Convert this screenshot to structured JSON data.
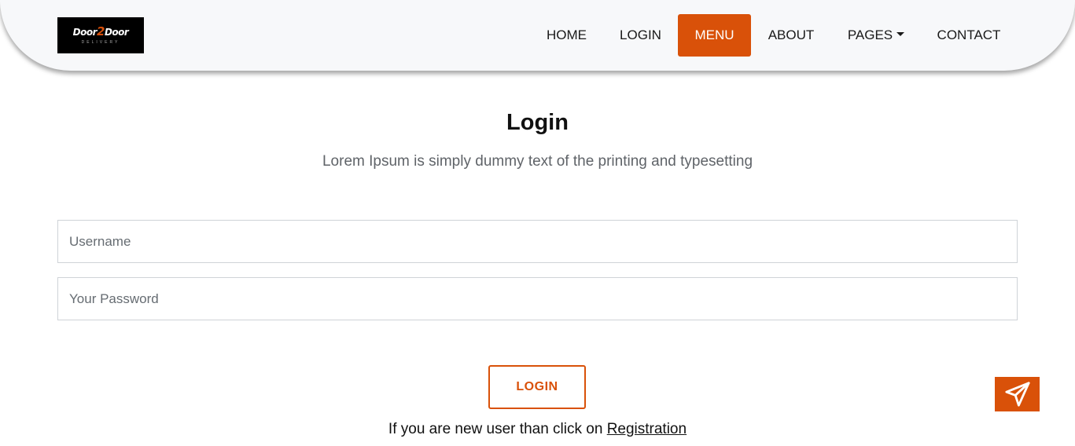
{
  "logo": {
    "text_part1": "Door",
    "text_part2": "2",
    "text_part3": "Door",
    "tagline": "DELIVERY"
  },
  "nav": {
    "items": [
      {
        "label": "HOME"
      },
      {
        "label": "LOGIN"
      },
      {
        "label": "MENU",
        "active": true
      },
      {
        "label": "ABOUT"
      },
      {
        "label": "PAGES",
        "dropdown": true
      },
      {
        "label": "CONTACT"
      }
    ]
  },
  "main": {
    "title": "Login",
    "subtitle": "Lorem Ipsum is simply dummy text of the printing and typesetting",
    "username_placeholder": "Username",
    "password_placeholder": "Your Password",
    "login_button": "LOGIN",
    "register_prompt": "If you are new user than click on ",
    "register_link": "Registration"
  },
  "floating": {
    "icon": "paper-plane-icon"
  },
  "colors": {
    "accent": "#d95109",
    "header_bg": "#f7f8fa",
    "text": "#111111",
    "muted": "#5f6368"
  }
}
